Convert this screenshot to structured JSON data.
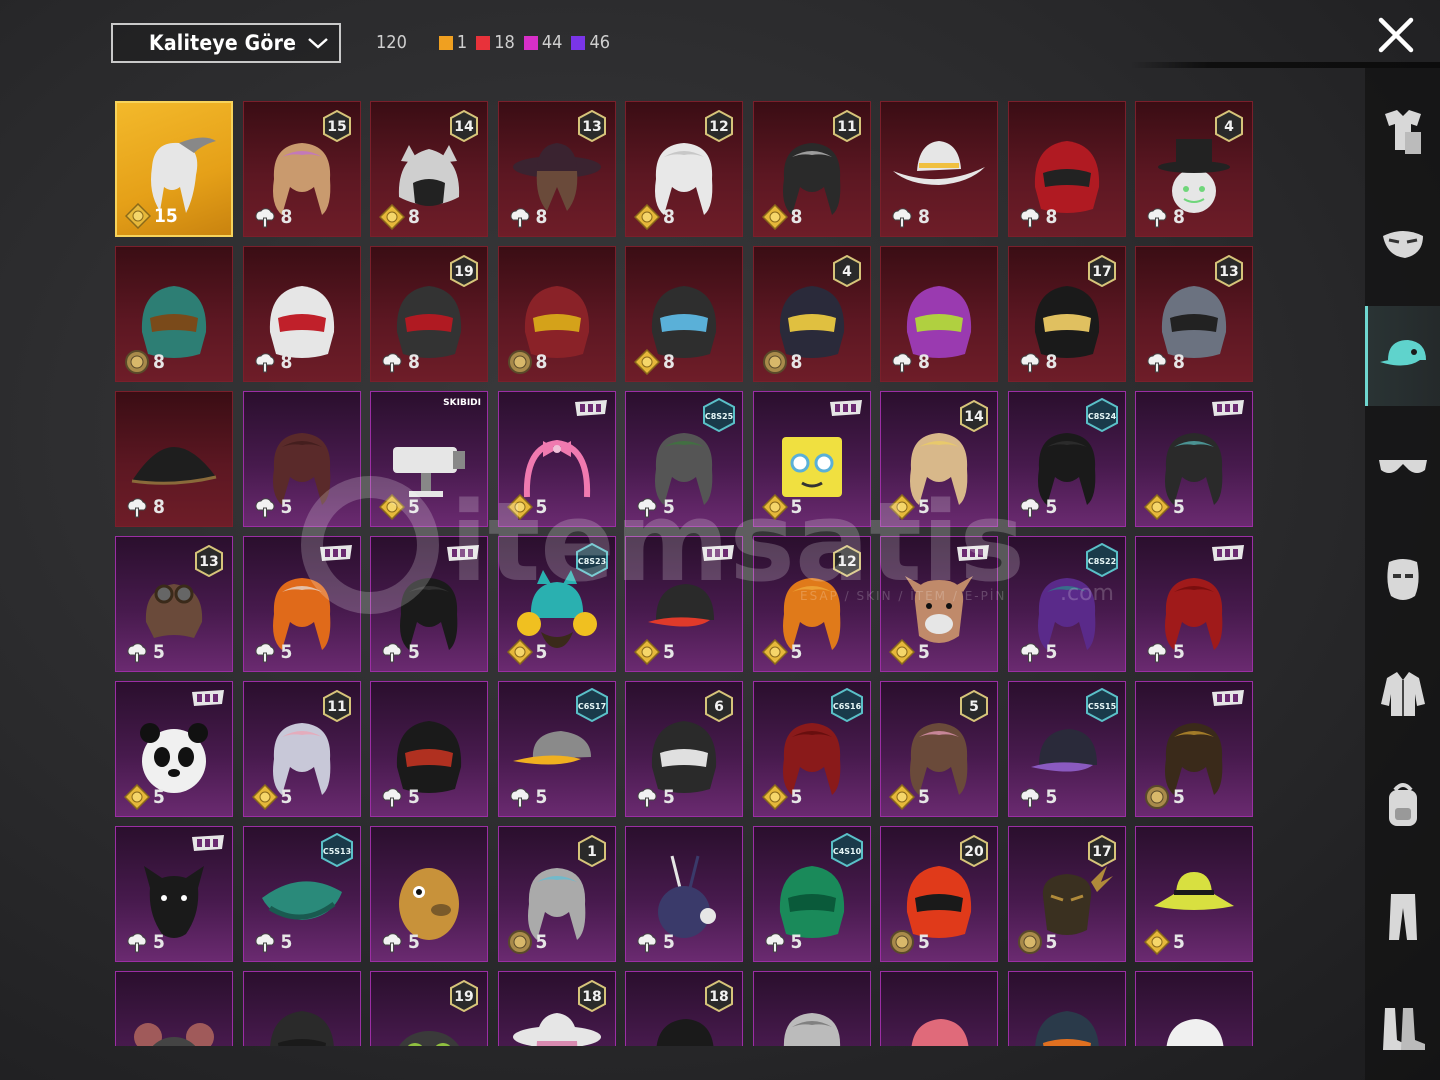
{
  "toolbar": {
    "sort_label": "Kaliteye Göre",
    "total": "120",
    "stats": [
      {
        "color": "#f0a020",
        "count": "1"
      },
      {
        "color": "#e8323a",
        "count": "18"
      },
      {
        "color": "#d82fc8",
        "count": "44"
      },
      {
        "color": "#7a35e8",
        "count": "46"
      }
    ]
  },
  "watermark": {
    "brand": "itemsatis",
    "tagline": "ESAP / SKIN / İTEM / E-PİN",
    "domain": ".com"
  },
  "sidebar": {
    "items": [
      {
        "name": "outfit",
        "icon": "outfit-icon",
        "active": false
      },
      {
        "name": "mask",
        "icon": "mask-icon",
        "active": false
      },
      {
        "name": "hat",
        "icon": "cap-icon",
        "active": true
      },
      {
        "name": "glasses",
        "icon": "glasses-icon",
        "active": false
      },
      {
        "name": "face",
        "icon": "face-icon",
        "active": false
      },
      {
        "name": "jacket",
        "icon": "jacket-icon",
        "active": false
      },
      {
        "name": "backpack",
        "icon": "backpack-icon",
        "active": false
      },
      {
        "name": "pants",
        "icon": "pants-icon",
        "active": false
      },
      {
        "name": "shoes",
        "icon": "boots-icon",
        "active": false
      }
    ]
  },
  "items": [
    {
      "rarity": "gold",
      "art": "hair-white",
      "c1": "#e6e6e6",
      "c2": "#888",
      "currency": "gold",
      "count": "15",
      "badge": ""
    },
    {
      "rarity": "red",
      "art": "hair",
      "c1": "#c99a6e",
      "c2": "#c06bd8",
      "currency": "cloud",
      "count": "8",
      "badge": "15"
    },
    {
      "rarity": "red",
      "art": "hood",
      "c1": "#cfcfcf",
      "c2": "#222",
      "currency": "gold",
      "count": "8",
      "badge": "14"
    },
    {
      "rarity": "red",
      "art": "hat",
      "c1": "#6a4a3a",
      "c2": "#3a2330",
      "currency": "cloud",
      "count": "8",
      "badge": "13"
    },
    {
      "rarity": "red",
      "art": "hair",
      "c1": "#e8e8e8",
      "c2": "#bbb",
      "currency": "gold",
      "count": "8",
      "badge": "12"
    },
    {
      "rarity": "red",
      "art": "hair",
      "c1": "#2a2a2a",
      "c2": "#cfcfcf",
      "currency": "gold",
      "count": "8",
      "badge": "11"
    },
    {
      "rarity": "red",
      "art": "cowboy",
      "c1": "#e6e6e6",
      "c2": "#f0c040",
      "currency": "cloud",
      "count": "8",
      "badge": ""
    },
    {
      "rarity": "red",
      "art": "helmet",
      "c1": "#b01a22",
      "c2": "#222",
      "currency": "cloud",
      "count": "8",
      "badge": ""
    },
    {
      "rarity": "red",
      "art": "tophat",
      "c1": "#222",
      "c2": "#6fd67a",
      "currency": "cloud",
      "count": "8",
      "badge": "4"
    },
    {
      "rarity": "red",
      "art": "helmet",
      "c1": "#2d7e74",
      "c2": "#7a4a1a",
      "currency": "coin",
      "count": "8",
      "badge": ""
    },
    {
      "rarity": "red",
      "art": "helmet",
      "c1": "#e6e6e6",
      "c2": "#c0202a",
      "currency": "cloud",
      "count": "8",
      "badge": ""
    },
    {
      "rarity": "red",
      "art": "helmet",
      "c1": "#333",
      "c2": "#b01a22",
      "currency": "cloud",
      "count": "8",
      "badge": "19"
    },
    {
      "rarity": "red",
      "art": "helmet",
      "c1": "#8a2228",
      "c2": "#d4a21a",
      "currency": "coin",
      "count": "8",
      "badge": ""
    },
    {
      "rarity": "red",
      "art": "helmet",
      "c1": "#2e2e2e",
      "c2": "#5ab0d8",
      "currency": "gold",
      "count": "8",
      "badge": ""
    },
    {
      "rarity": "red",
      "art": "helmet",
      "c1": "#2a2a3a",
      "c2": "#e0c040",
      "currency": "coin",
      "count": "8",
      "badge": "4"
    },
    {
      "rarity": "red",
      "art": "helmet",
      "c1": "#9a3ab0",
      "c2": "#b0d040",
      "currency": "cloud",
      "count": "8",
      "badge": ""
    },
    {
      "rarity": "red",
      "art": "helmet",
      "c1": "#1a1a1a",
      "c2": "#e0c060",
      "currency": "cloud",
      "count": "8",
      "badge": "17"
    },
    {
      "rarity": "red",
      "art": "helmet",
      "c1": "#6b7280",
      "c2": "#222",
      "currency": "cloud",
      "count": "8",
      "badge": "13"
    },
    {
      "rarity": "red",
      "art": "tricorn",
      "c1": "#1e1e1e",
      "c2": "#8a6a3a",
      "currency": "cloud",
      "count": "8",
      "badge": ""
    },
    {
      "rarity": "purple",
      "art": "hair",
      "c1": "#5a2a2a",
      "c2": "#3a1a1a",
      "currency": "cloud",
      "count": "5",
      "badge": ""
    },
    {
      "rarity": "purple",
      "art": "camera",
      "c1": "#e6e6e6",
      "c2": "#888",
      "currency": "gold",
      "count": "5",
      "badge": "",
      "label": "SKIBIDI"
    },
    {
      "rarity": "purple",
      "art": "headband",
      "c1": "#f07ab0",
      "c2": "#f07ab0",
      "currency": "gold",
      "count": "5",
      "badge": "",
      "pbadge": true
    },
    {
      "rarity": "purple",
      "art": "hair",
      "c1": "#555",
      "c2": "#3a7a3a",
      "currency": "cloud",
      "count": "5",
      "badge": "",
      "cbadge": "C8S25"
    },
    {
      "rarity": "purple",
      "art": "box",
      "c1": "#f0e040",
      "c2": "#5ab0d8",
      "currency": "gold",
      "count": "5",
      "badge": "",
      "pbadge": true
    },
    {
      "rarity": "purple",
      "art": "hair",
      "c1": "#d8b88a",
      "c2": "#f0d060",
      "currency": "gold",
      "count": "5",
      "badge": "14"
    },
    {
      "rarity": "purple",
      "art": "hair",
      "c1": "#1a1a1a",
      "c2": "#333",
      "currency": "cloud",
      "count": "5",
      "badge": "",
      "cbadge": "C8S24"
    },
    {
      "rarity": "purple",
      "art": "hair",
      "c1": "#2a2a2a",
      "c2": "#5ac0c0",
      "currency": "gold",
      "count": "5",
      "badge": "",
      "pbadge": true
    },
    {
      "rarity": "purple",
      "art": "aviator",
      "c1": "#6a4a3a",
      "c2": "#3a2a1a",
      "currency": "cloud",
      "count": "5",
      "badge": "13"
    },
    {
      "rarity": "purple",
      "art": "hair",
      "c1": "#e06a1a",
      "c2": "#e6e6e6",
      "currency": "cloud",
      "count": "5",
      "badge": "",
      "pbadge": true
    },
    {
      "rarity": "purple",
      "art": "hair",
      "c1": "#1a1a1a",
      "c2": "#3a3a3a",
      "currency": "cloud",
      "count": "5",
      "badge": "",
      "pbadge": true
    },
    {
      "rarity": "purple",
      "art": "headphones",
      "c1": "#2ab0b0",
      "c2": "#f0c020",
      "currency": "gold",
      "count": "5",
      "badge": "",
      "cbadge": "C8S23"
    },
    {
      "rarity": "purple",
      "art": "cap",
      "c1": "#2a2a2a",
      "c2": "#e03a2a",
      "currency": "gold",
      "count": "5",
      "badge": "",
      "pbadge": true
    },
    {
      "rarity": "purple",
      "art": "hair",
      "c1": "#e07a1a",
      "c2": "#f0b040",
      "currency": "gold",
      "count": "5",
      "badge": "12"
    },
    {
      "rarity": "purple",
      "art": "animal",
      "c1": "#c08a6a",
      "c2": "#e6e6e6",
      "currency": "gold",
      "count": "5",
      "badge": "",
      "pbadge": true
    },
    {
      "rarity": "purple",
      "art": "hair",
      "c1": "#5a2a8a",
      "c2": "#2a8a8a",
      "currency": "cloud",
      "count": "5",
      "badge": "",
      "cbadge": "C8S22"
    },
    {
      "rarity": "purple",
      "art": "hair",
      "c1": "#a01a1a",
      "c2": "#6a0a0a",
      "currency": "cloud",
      "count": "5",
      "badge": "",
      "pbadge": true
    },
    {
      "rarity": "purple",
      "art": "panda",
      "c1": "#f0f0f0",
      "c2": "#111",
      "currency": "gold",
      "count": "5",
      "badge": "",
      "pbadge": true
    },
    {
      "rarity": "purple",
      "art": "hair",
      "c1": "#c8c8d8",
      "c2": "#f0a0b0",
      "currency": "gold",
      "count": "5",
      "badge": "11"
    },
    {
      "rarity": "purple",
      "art": "helmet",
      "c1": "#1a1a1a",
      "c2": "#b03020",
      "currency": "cloud",
      "count": "5",
      "badge": ""
    },
    {
      "rarity": "purple",
      "art": "visor",
      "c1": "#f0b020",
      "c2": "#8a8a8a",
      "currency": "cloud",
      "count": "5",
      "badge": "",
      "cbadge": "C6S17"
    },
    {
      "rarity": "purple",
      "art": "helmet",
      "c1": "#2a2a2a",
      "c2": "#e0e0e0",
      "currency": "cloud",
      "count": "5",
      "badge": "6"
    },
    {
      "rarity": "purple",
      "art": "hair",
      "c1": "#8a1a1a",
      "c2": "#5a0a0a",
      "currency": "gold",
      "count": "5",
      "badge": "",
      "cbadge": "C6S16"
    },
    {
      "rarity": "purple",
      "art": "hair",
      "c1": "#6a4a3a",
      "c2": "#f0a0c0",
      "currency": "gold",
      "count": "5",
      "badge": "5"
    },
    {
      "rarity": "purple",
      "art": "cap",
      "c1": "#2a2a3a",
      "c2": "#8a5ac0",
      "currency": "cloud",
      "count": "5",
      "badge": "",
      "cbadge": "C5S15"
    },
    {
      "rarity": "purple",
      "art": "hair",
      "c1": "#3a2a1a",
      "c2": "#d0a030",
      "currency": "coin",
      "count": "5",
      "badge": "",
      "pbadge": true
    },
    {
      "rarity": "purple",
      "art": "panther",
      "c1": "#1a1a1a",
      "c2": "#444",
      "currency": "cloud",
      "count": "5",
      "badge": "",
      "pbadge": true
    },
    {
      "rarity": "purple",
      "art": "beret",
      "c1": "#2a8a7a",
      "c2": "#1a5a50",
      "currency": "cloud",
      "count": "5",
      "badge": "",
      "cbadge": "C5S13"
    },
    {
      "rarity": "purple",
      "art": "potato",
      "c1": "#c8923a",
      "c2": "#7a5a2a",
      "currency": "cloud",
      "count": "5",
      "badge": ""
    },
    {
      "rarity": "purple",
      "art": "hair",
      "c1": "#aaa",
      "c2": "#5ac0d8",
      "currency": "coin",
      "count": "5",
      "badge": "1"
    },
    {
      "rarity": "purple",
      "art": "bunny",
      "c1": "#3a3a6a",
      "c2": "#e6e6e6",
      "currency": "cloud",
      "count": "5",
      "badge": ""
    },
    {
      "rarity": "purple",
      "art": "helmet",
      "c1": "#1a8a5a",
      "c2": "#0a5a3a",
      "currency": "cloud",
      "count": "5",
      "badge": "",
      "cbadge": "C4S10"
    },
    {
      "rarity": "purple",
      "art": "helmet",
      "c1": "#e03a1a",
      "c2": "#1a1a1a",
      "currency": "coin",
      "count": "5",
      "badge": "20"
    },
    {
      "rarity": "purple",
      "art": "antlers",
      "c1": "#3a3020",
      "c2": "#b08a3a",
      "currency": "coin",
      "count": "5",
      "badge": "17"
    },
    {
      "rarity": "purple",
      "art": "bucket",
      "c1": "#d8e040",
      "c2": "#1a1a1a",
      "currency": "gold",
      "count": "5",
      "badge": ""
    },
    {
      "rarity": "purple",
      "art": "rat",
      "c1": "#444",
      "c2": "#a05a5a",
      "currency": "none",
      "count": "",
      "badge": ""
    },
    {
      "rarity": "purple",
      "art": "helmet",
      "c1": "#2a2a2a",
      "c2": "#1a1a1a",
      "currency": "none",
      "count": "",
      "badge": ""
    },
    {
      "rarity": "purple",
      "art": "goggles",
      "c1": "#3a3a3a",
      "c2": "#90c040",
      "currency": "none",
      "count": "",
      "badge": "19"
    },
    {
      "rarity": "purple",
      "art": "hat",
      "c1": "#d88ab0",
      "c2": "#e6e6e6",
      "currency": "none",
      "count": "",
      "badge": "18"
    },
    {
      "rarity": "purple",
      "art": "cap",
      "c1": "#1a1a1a",
      "c2": "#1a8a5a",
      "currency": "none",
      "count": "",
      "badge": "18"
    },
    {
      "rarity": "purple",
      "art": "hair",
      "c1": "#bbb",
      "c2": "#666",
      "currency": "none",
      "count": "",
      "badge": ""
    },
    {
      "rarity": "purple",
      "art": "cap",
      "c1": "#e06a7a",
      "c2": "#d04050",
      "currency": "none",
      "count": "",
      "badge": ""
    },
    {
      "rarity": "purple",
      "art": "helmet",
      "c1": "#2a3a4a",
      "c2": "#e07020",
      "currency": "none",
      "count": "",
      "badge": ""
    },
    {
      "rarity": "purple",
      "art": "cap",
      "c1": "#f0f0f0",
      "c2": "#f0a0c0",
      "currency": "none",
      "count": "",
      "badge": ""
    }
  ]
}
